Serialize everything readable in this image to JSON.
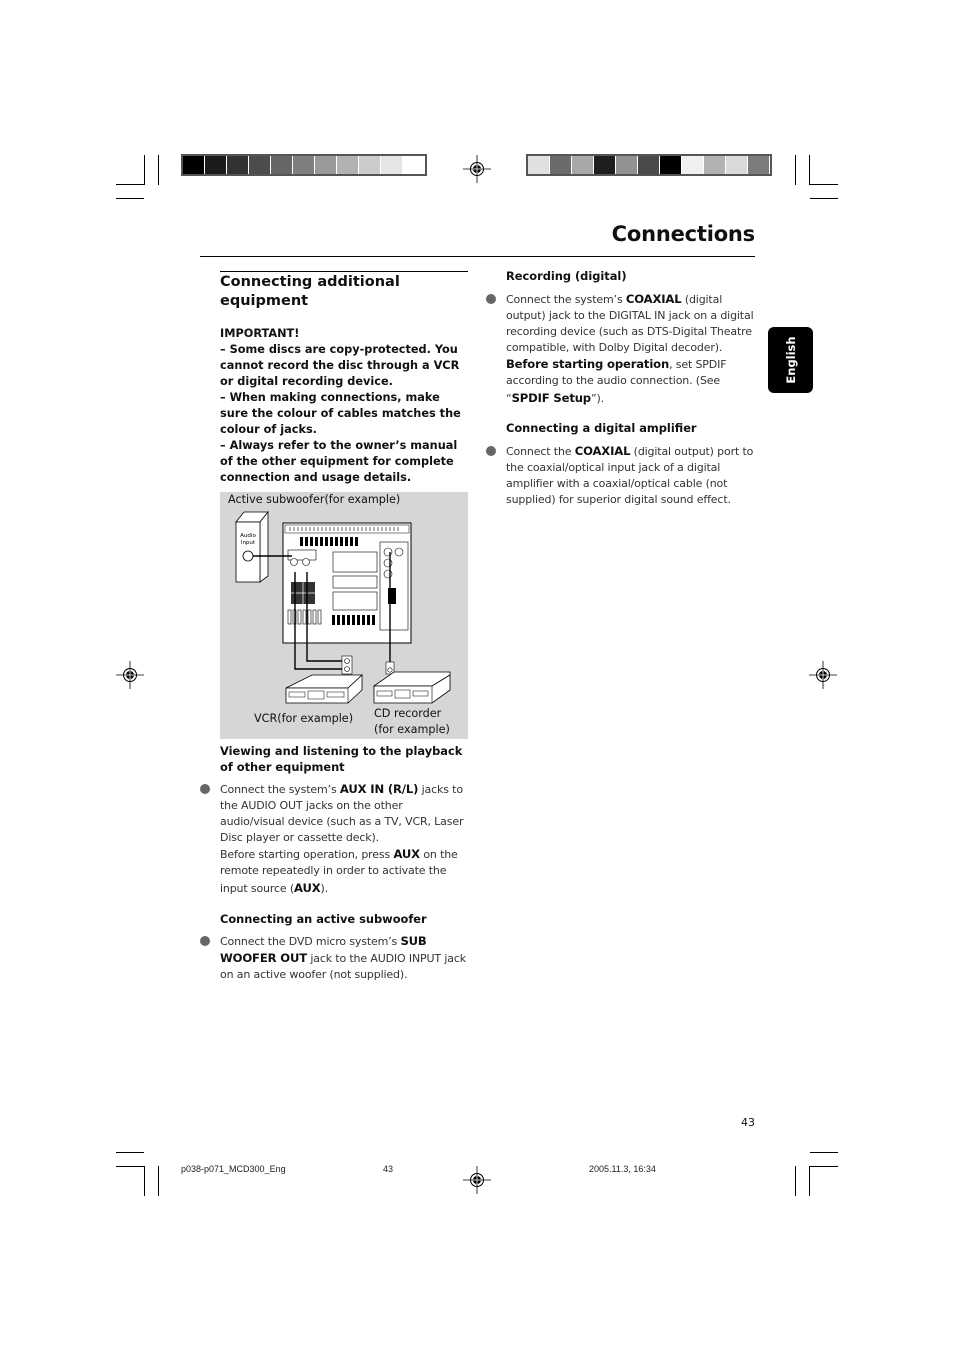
{
  "header": {
    "title": "Connections"
  },
  "color_bars": {
    "left": [
      "#000000",
      "#1b1b1b",
      "#333333",
      "#4c4c4c",
      "#666666",
      "#7f7f7f",
      "#999999",
      "#b2b2b2",
      "#cccccc",
      "#e5e5e5",
      "#ffffff"
    ],
    "right": [
      "#e0e0e0",
      "#6b6b6b",
      "#a8a8a8",
      "#1e1e1e",
      "#919191",
      "#4a4a4a",
      "#000000",
      "#f0f0f0",
      "#b2b2b2",
      "#dadada",
      "#7c7c7c"
    ]
  },
  "side_tab": {
    "label": "English"
  },
  "left_column": {
    "section_title": "Connecting additional equipment",
    "important": {
      "heading": "IMPORTANT!",
      "items": [
        "–  Some discs are copy-protected. You cannot record the disc through a VCR or digital recording device.",
        "–  When making connections, make sure the colour of cables matches the colour of jacks.",
        "–  Always refer to the owner’s manual of the other equipment for complete connection and usage details."
      ]
    },
    "figure": {
      "caption_top": "Active subwoofer(for example)",
      "subwoofer_label": "Audio input",
      "vcr_label": "VCR(for example)",
      "cd_label_1": "CD recorder",
      "cd_label_2": "(for example)"
    },
    "viewing": {
      "heading": "Viewing and listening to the playback of other equipment",
      "p1_a": "Connect the system’s ",
      "p1_b": "AUX IN (R/L)",
      "p1_c": " jacks to the AUDIO OUT jacks on the other audio/visual device (such as a TV, VCR, Laser Disc player or cassette deck).",
      "p2_a": "Before starting operation, press ",
      "p2_b": "AUX",
      "p2_c": " on the remote repeatedly in order to activate the input source (",
      "p2_d": "AUX",
      "p2_e": ")."
    },
    "subwoofer": {
      "heading": "Connecting an active subwoofer",
      "p_a": "Connect the DVD micro system’s ",
      "p_b": "SUB WOOFER OUT",
      "p_c": " jack to the AUDIO INPUT jack on an active woofer (not supplied)."
    }
  },
  "right_column": {
    "recording": {
      "heading": "Recording (digital)",
      "p_a": "Connect the system’s ",
      "p_b": "COAXIAL",
      "p_c": " (digital output) jack to the DIGITAL IN jack on a digital recording device (such as DTS-Digital Theatre compatible, with Dolby Digital decoder).",
      "p_d": "Before starting operation",
      "p_e": ", set  SPDIF according to the audio connection. (See “",
      "p_f": "SPDIF Setup",
      "p_g": "”)."
    },
    "amplifier": {
      "heading": "Connecting a digital amplifier",
      "p_a": "Connect the ",
      "p_b": "COAXIAL",
      "p_c": " (digital output) port to the coaxial/optical input jack of a digital amplifier with a coaxial/optical cable (not supplied) for superior digital sound effect."
    }
  },
  "page_number": "43",
  "footer": {
    "file": "p038-p071_MCD300_Eng",
    "page": "43",
    "date": "2005.11.3, 16:34"
  }
}
